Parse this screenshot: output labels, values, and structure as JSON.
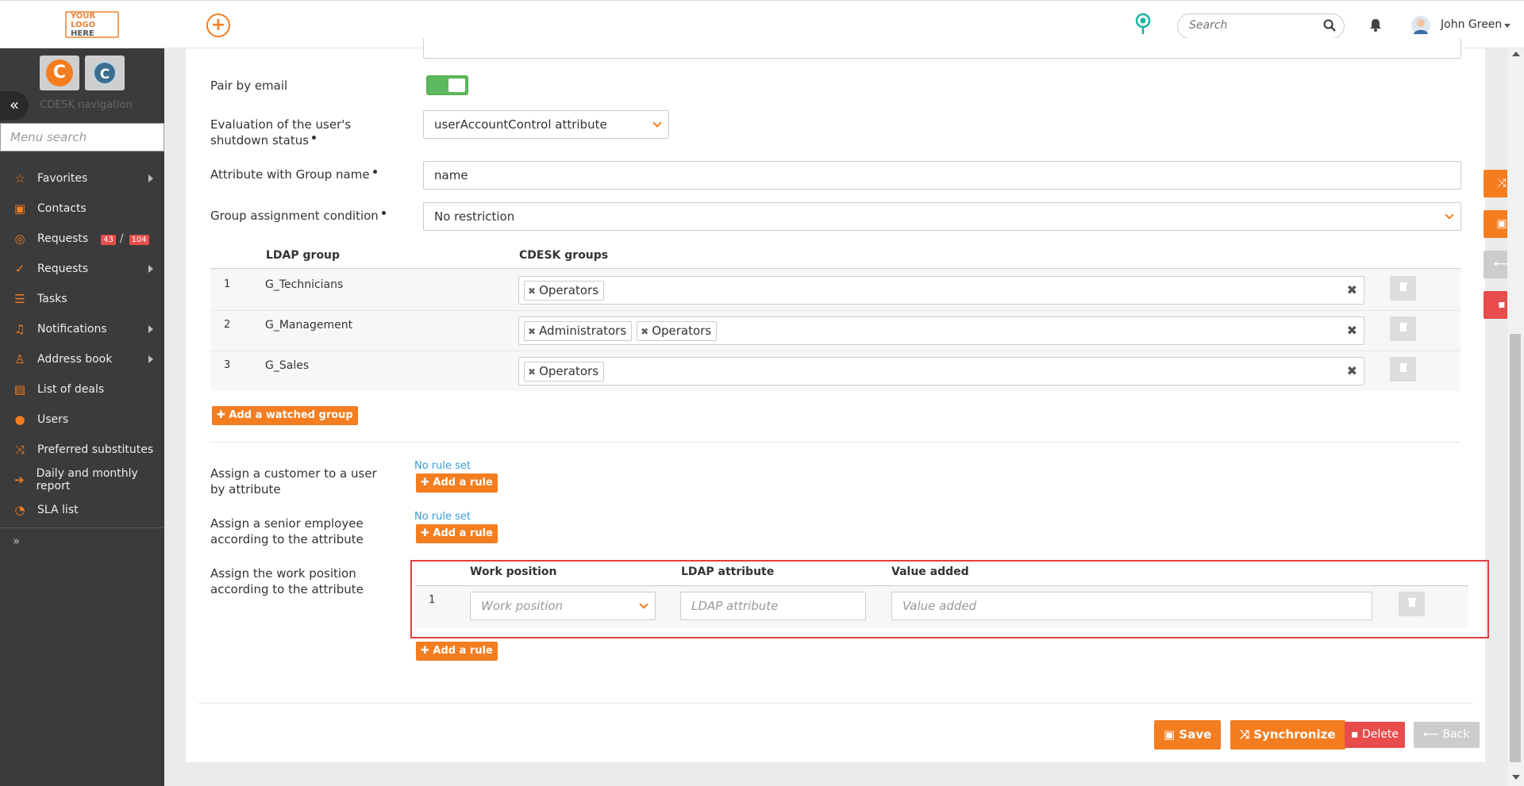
{
  "topbar": {
    "logo_line1": "YOUR LOGO",
    "logo_line2": "HERE",
    "add_icon": "+",
    "search_placeholder": "Search",
    "user_name": "John Green"
  },
  "sidebar": {
    "nav_title": "CDESK navigation",
    "menu_search_placeholder": "Menu search",
    "items": [
      {
        "label": "Favorites",
        "icon": "star-icon",
        "glyph": "☆",
        "arrow": true
      },
      {
        "label": "Contacts",
        "icon": "contacts-icon",
        "glyph": "▣",
        "arrow": false
      },
      {
        "label": "Requests",
        "icon": "requests-icon",
        "glyph": "◎",
        "arrow": false,
        "badge1": "43",
        "badge2": "104"
      },
      {
        "label": "Requests",
        "icon": "check-circle-icon",
        "glyph": "✓",
        "arrow": true
      },
      {
        "label": "Tasks",
        "icon": "tasks-icon",
        "glyph": "☰",
        "arrow": false
      },
      {
        "label": "Notifications",
        "icon": "bell-icon",
        "glyph": "♫",
        "arrow": true
      },
      {
        "label": "Address book",
        "icon": "person-icon",
        "glyph": "♙",
        "arrow": true
      },
      {
        "label": "List of deals",
        "icon": "briefcase-icon",
        "glyph": "▤",
        "arrow": false
      },
      {
        "label": "Users",
        "icon": "user-icon",
        "glyph": "●",
        "arrow": false
      },
      {
        "label": "Preferred substitutes",
        "icon": "shuffle-icon",
        "glyph": "⤨",
        "arrow": false
      },
      {
        "label": "Daily and monthly report",
        "icon": "sign-in-icon",
        "glyph": "➔",
        "arrow": false
      },
      {
        "label": "SLA list",
        "icon": "stopwatch-icon",
        "glyph": "◔",
        "arrow": false
      }
    ],
    "more": "»"
  },
  "form": {
    "pair_by_email_label": "Pair by email",
    "shutdown_label": "Evaluation of the user's shutdown status",
    "shutdown_value": "userAccountControl attribute",
    "group_attr_label": "Attribute with Group name",
    "group_attr_value": "name",
    "group_condition_label": "Group assignment condition",
    "group_condition_value": "No restriction",
    "col_ldap_group": "LDAP group",
    "col_cdesk_groups": "CDESK groups",
    "groups": [
      {
        "num": "1",
        "ldap": "G_Technicians",
        "tags": [
          "Operators"
        ]
      },
      {
        "num": "2",
        "ldap": "G_Management",
        "tags": [
          "Administrators",
          "Operators"
        ]
      },
      {
        "num": "3",
        "ldap": "G_Sales",
        "tags": [
          "Operators"
        ]
      }
    ],
    "add_group_btn": "✚ Add a watched group",
    "customer_label": "Assign a customer to a user by attribute",
    "senior_label": "Assign a senior employee according to the attribute",
    "work_label": "Assign the work position according to the attribute",
    "no_rule": "No rule set",
    "add_rule_btn": "✚ Add a rule",
    "col_work_position": "Work position",
    "col_ldap_attribute": "LDAP attribute",
    "col_value_added": "Value added",
    "rule_num": "1",
    "ph_work_position": "Work position",
    "ph_ldap_attribute": "LDAP attribute",
    "ph_value_added": "Value added"
  },
  "buttons": {
    "save": "Save",
    "synchronize": "Synchronize",
    "delete": "Delete",
    "back": "Back"
  },
  "colors": {
    "accent": "#f47d20",
    "danger": "#e84c4c",
    "success": "#5cb85c"
  }
}
